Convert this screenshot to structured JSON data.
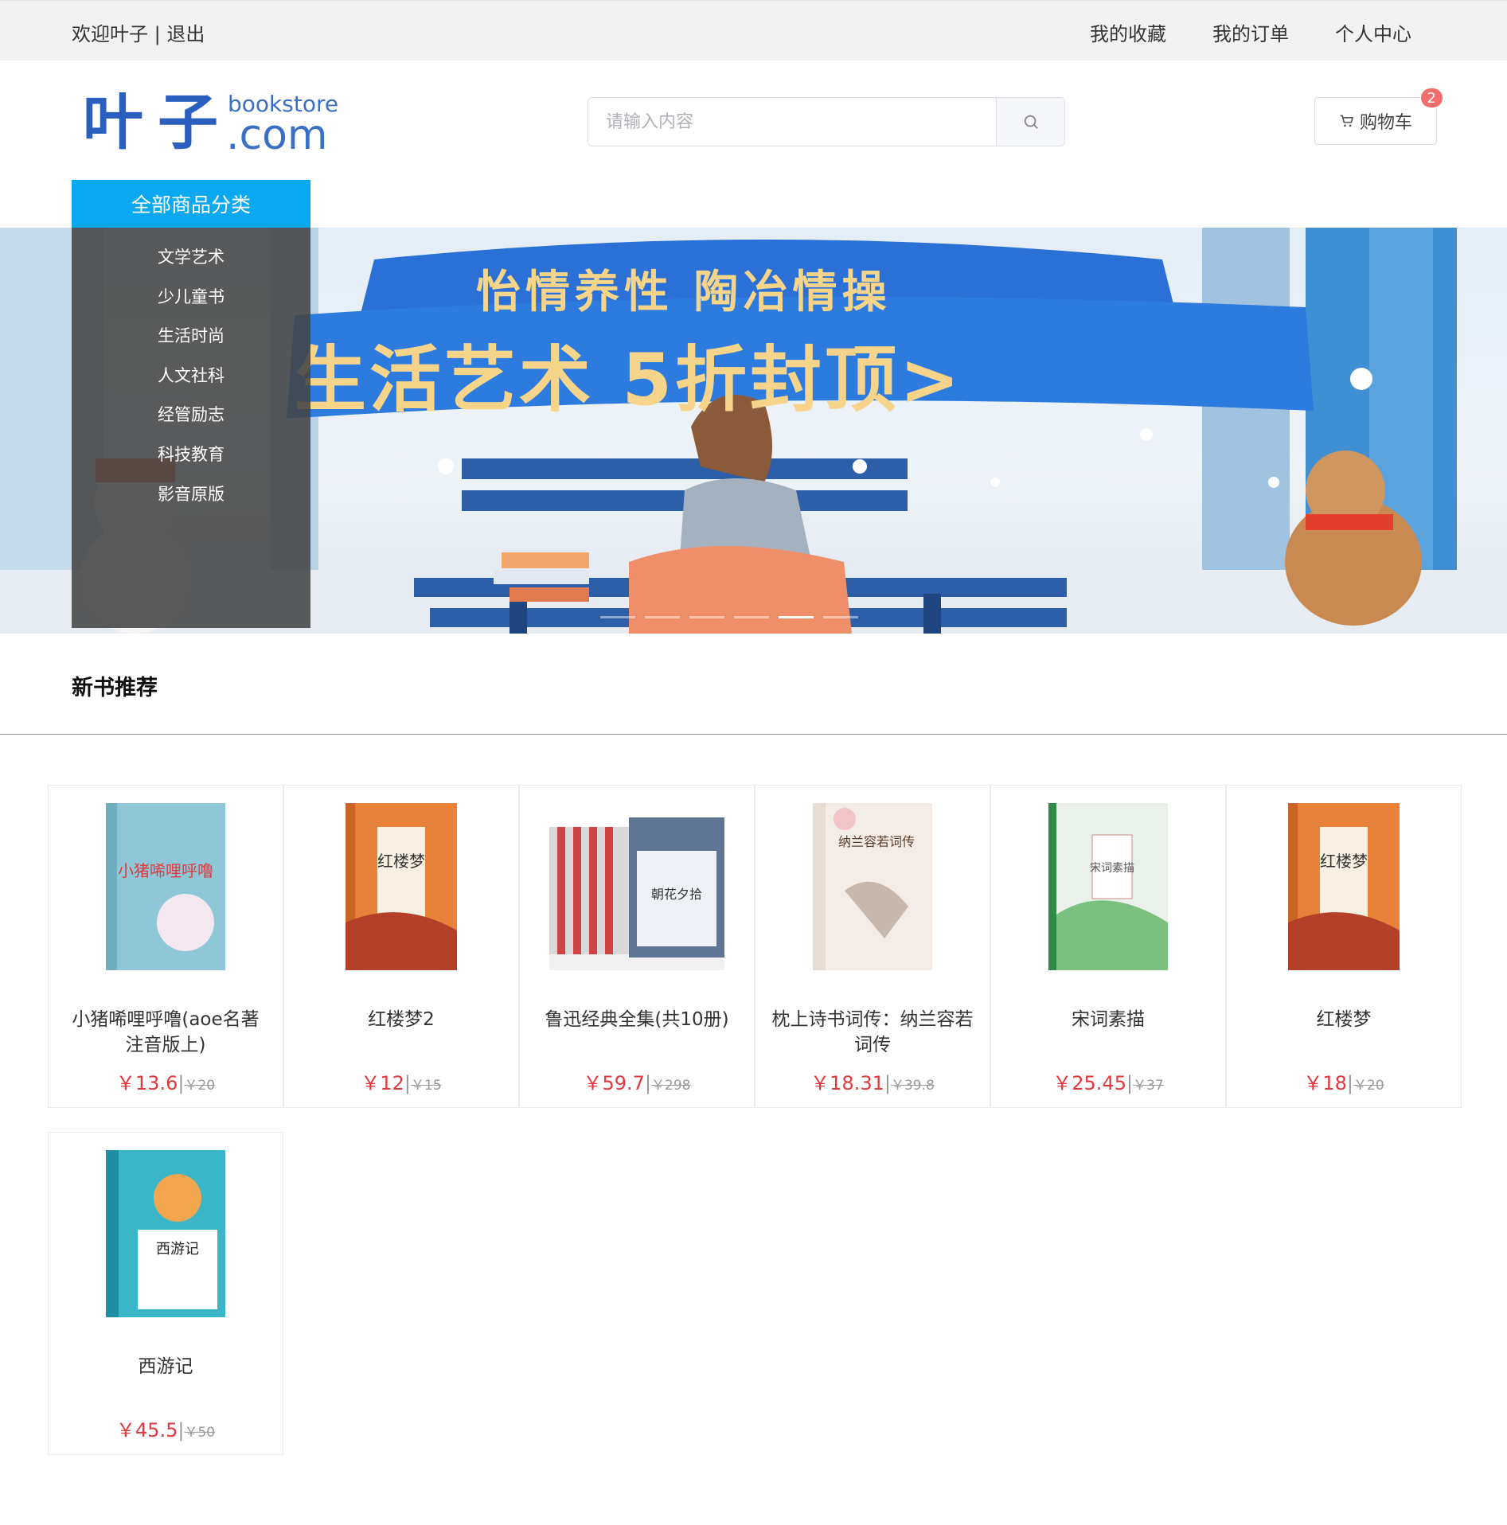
{
  "topbar": {
    "welcome": "欢迎叶子",
    "separator": "|",
    "logout": "退出",
    "nav": [
      "我的收藏",
      "我的订单",
      "个人中心"
    ]
  },
  "logo": {
    "cn": "叶子",
    "en_top": "bookstore",
    "en_bottom": ".com"
  },
  "search": {
    "placeholder": "请输入内容",
    "icon": "search-icon"
  },
  "cart": {
    "label": "购物车",
    "count": "2",
    "icon": "cart-icon"
  },
  "categories": {
    "title": "全部商品分类",
    "items": [
      "文学艺术",
      "少儿童书",
      "生活时尚",
      "人文社科",
      "经管励志",
      "科技教育",
      "影音原版"
    ]
  },
  "banner": {
    "headline_top": "怡情养性 陶冶情操",
    "headline_main": "生活艺术 5折封顶>",
    "slides": 6,
    "active_slide": 4
  },
  "section": {
    "title": "新书推荐"
  },
  "currency": "￥",
  "products": [
    {
      "name": "小猪唏哩呼噜(aoe名著注音版上)",
      "price": "13.6",
      "old_price": "20",
      "cover_color": "#8fc7d8",
      "cover_text": "小猪唏哩呼噜"
    },
    {
      "name": "红楼梦2",
      "price": "12",
      "old_price": "15",
      "cover_color": "#e8823a",
      "cover_text": "红楼梦"
    },
    {
      "name": "鲁迅经典全集(共10册)",
      "price": "59.7",
      "old_price": "298",
      "cover_color": "#f1f1f1",
      "cover_text": "朝花夕拾"
    },
    {
      "name": "枕上诗书词传：纳兰容若词传",
      "price": "18.31",
      "old_price": "39.8",
      "cover_color": "#f4ece6",
      "cover_text": "纳兰容若词传"
    },
    {
      "name": "宋词素描",
      "price": "25.45",
      "old_price": "37",
      "cover_color": "#e9f1ea",
      "cover_text": "宋词素描"
    },
    {
      "name": "红楼梦",
      "price": "18",
      "old_price": "20",
      "cover_color": "#e8823a",
      "cover_text": "红楼梦"
    },
    {
      "name": "西游记",
      "price": "45.5",
      "old_price": "50",
      "cover_color": "#3ab6c8",
      "cover_text": "西游记"
    }
  ]
}
